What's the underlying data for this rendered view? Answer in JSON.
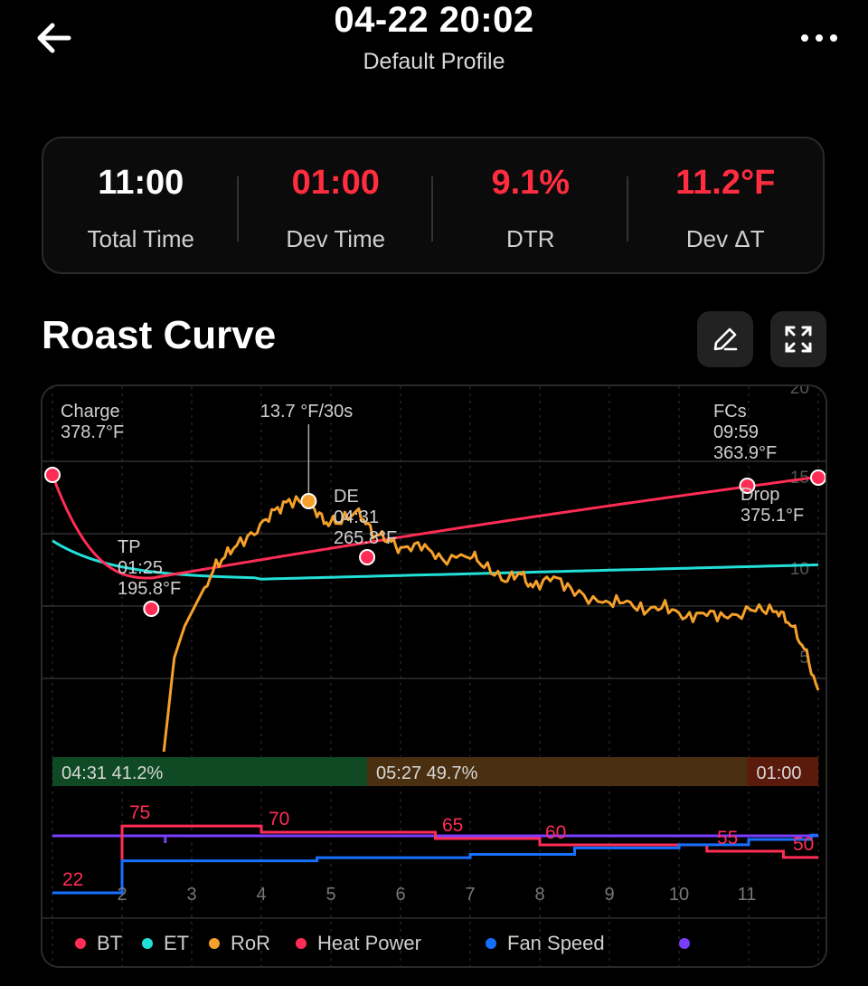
{
  "header": {
    "title": "04-22 20:02",
    "subtitle": "Default Profile"
  },
  "stats": [
    {
      "value": "11:00",
      "label": "Total Time",
      "color": "#ffffff"
    },
    {
      "value": "01:00",
      "label": "Dev Time",
      "color": "#ff2d3f"
    },
    {
      "value": "9.1%",
      "label": "DTR",
      "color": "#ff2d3f"
    },
    {
      "value": "11.2°F",
      "label": "Dev ΔT",
      "color": "#ff2d3f"
    }
  ],
  "section": {
    "title": "Roast Curve"
  },
  "colors": {
    "bt": "#ff2d55",
    "et": "#22e0d8",
    "ror": "#f5a02a",
    "heat": "#ff2d55",
    "fan": "#1670ff",
    "purple": "#7a3cff",
    "phase_dry": "#0f4a24",
    "phase_maillard": "#4a3010",
    "phase_dev": "#5a1a0c"
  },
  "chart_data": {
    "type": "line",
    "x_ticks": [
      "2",
      "3",
      "4",
      "5",
      "6",
      "7",
      "8",
      "9",
      "10",
      "11"
    ],
    "right_ticks": [
      "20",
      "15",
      "10",
      "5"
    ],
    "events": [
      {
        "name": "Charge",
        "time": "",
        "temp": "378.7°F",
        "t": 0,
        "v": 378.7
      },
      {
        "name": "TP",
        "time": "01:25",
        "temp": "195.8°F",
        "t": 1.42,
        "v": 195.8
      },
      {
        "name": "DE",
        "time": "04:31",
        "temp": "265.8°F",
        "t": 4.52,
        "v": 265.8
      },
      {
        "name": "FCs",
        "time": "09:59",
        "temp": "363.9°F",
        "t": 9.98,
        "v": 363.9
      },
      {
        "name": "Drop",
        "time": "",
        "temp": "375.1°F",
        "t": 11,
        "v": 375.1
      }
    ],
    "ror_peak_label": "13.7 °F/30s",
    "phases": [
      {
        "label": "04:31 41.2%",
        "start": 0,
        "end": 4.52
      },
      {
        "label": "05:27 49.7%",
        "start": 4.52,
        "end": 9.98
      },
      {
        "label": "01:00",
        "start": 9.98,
        "end": 11
      }
    ],
    "heat_power": [
      {
        "t": 0,
        "v": 22
      },
      {
        "t": 1,
        "v": 75
      },
      {
        "t": 3,
        "v": 70
      },
      {
        "t": 5.5,
        "v": 65
      },
      {
        "t": 7,
        "v": 60
      },
      {
        "t": 9.4,
        "v": 55
      },
      {
        "t": 10.5,
        "v": 50
      }
    ],
    "heat_labels": [
      "22",
      "75",
      "70",
      "65",
      "60",
      "55",
      "50"
    ],
    "fan_speed": [
      {
        "t": 0,
        "v": 20
      },
      {
        "t": 1,
        "v": 50
      },
      {
        "t": 3.8,
        "v": 53
      },
      {
        "t": 6,
        "v": 56
      },
      {
        "t": 7.5,
        "v": 62
      },
      {
        "t": 9,
        "v": 65
      },
      {
        "t": 10,
        "v": 70
      },
      {
        "t": 10.9,
        "v": 74
      }
    ],
    "legend": [
      {
        "label": "BT",
        "color": "#ff2d55"
      },
      {
        "label": "ET",
        "color": "#22e0d8"
      },
      {
        "label": "RoR",
        "color": "#f5a02a"
      },
      {
        "label": "Heat Power",
        "color": "#ff2d55"
      },
      {
        "label": "Fan Speed",
        "color": "#1670ff"
      },
      {
        "label": "",
        "color": "#7a3cff"
      }
    ]
  }
}
